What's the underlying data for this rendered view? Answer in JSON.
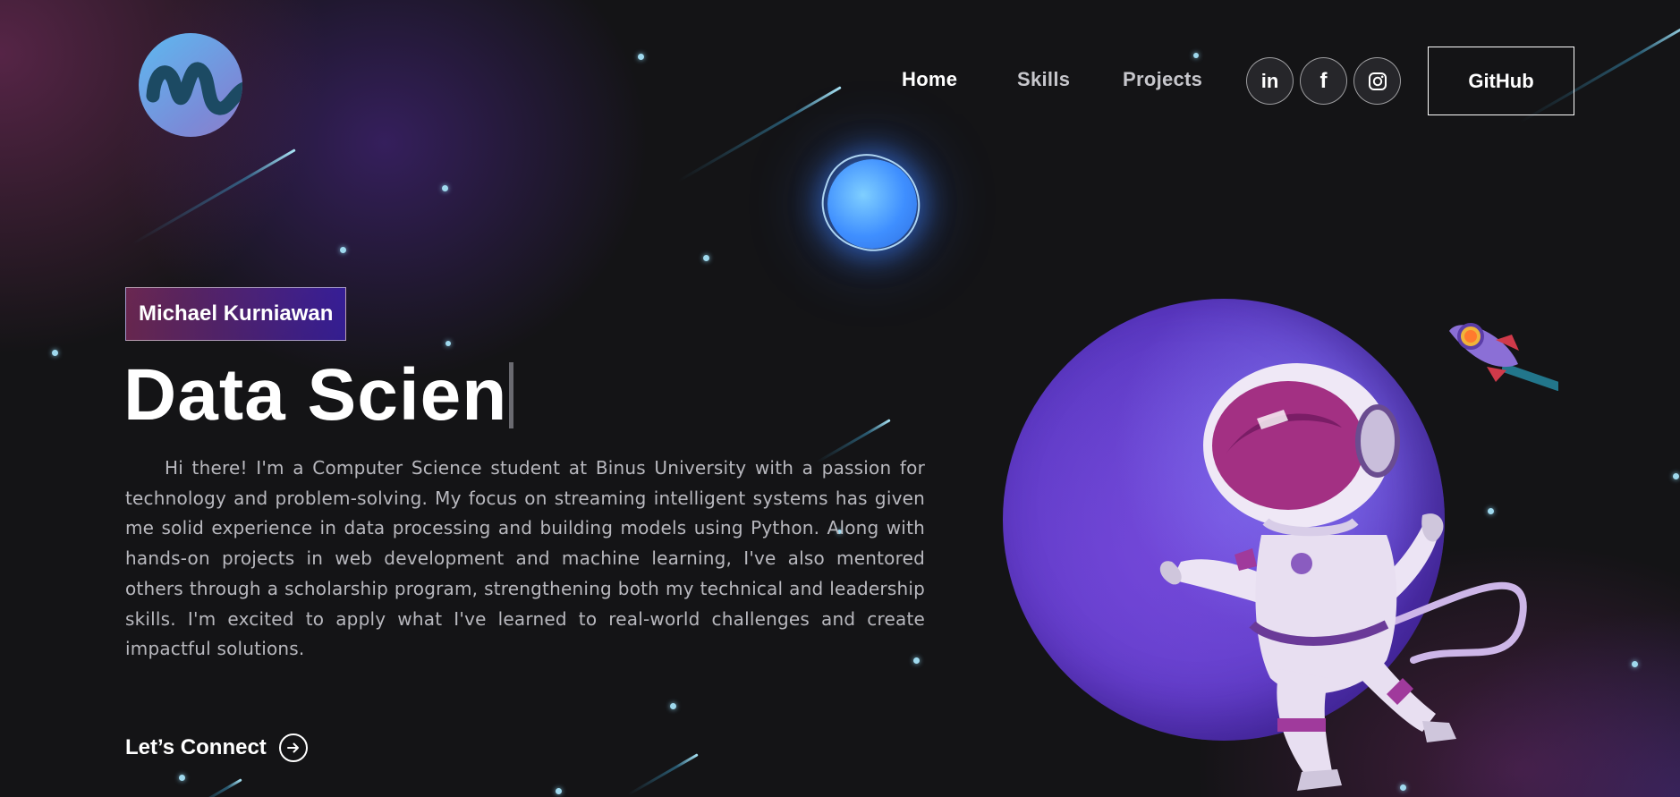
{
  "nav": {
    "links": [
      {
        "label": "Home",
        "active": true
      },
      {
        "label": "Skills",
        "active": false
      },
      {
        "label": "Projects",
        "active": false
      }
    ],
    "social": [
      {
        "icon": "linkedin-icon",
        "label": "in"
      },
      {
        "icon": "facebook-icon",
        "label": "f"
      },
      {
        "icon": "instagram-icon",
        "label": ""
      }
    ],
    "github_label": "GitHub"
  },
  "hero": {
    "name_tag": "Michael Kurniawan",
    "headline": "Data Scien",
    "bio": "Hi there! I'm a Computer Science student at Binus University with a passion for technology and problem-solving. My focus on streaming intelligent systems has given me solid experience in data processing and building models using Python. Along with hands-on projects in web development and machine learning, I've also mentored others through a scholarship program, strengthening both my technical and leadership skills. I'm excited to apply what I've learned to real-world challenges and create impactful solutions.",
    "cta_label": "Let’s Connect"
  },
  "colors": {
    "background": "#141416",
    "tag_gradient_start": "#aa367c",
    "tag_gradient_end": "#4823ea",
    "planet": "#5b38c2"
  }
}
